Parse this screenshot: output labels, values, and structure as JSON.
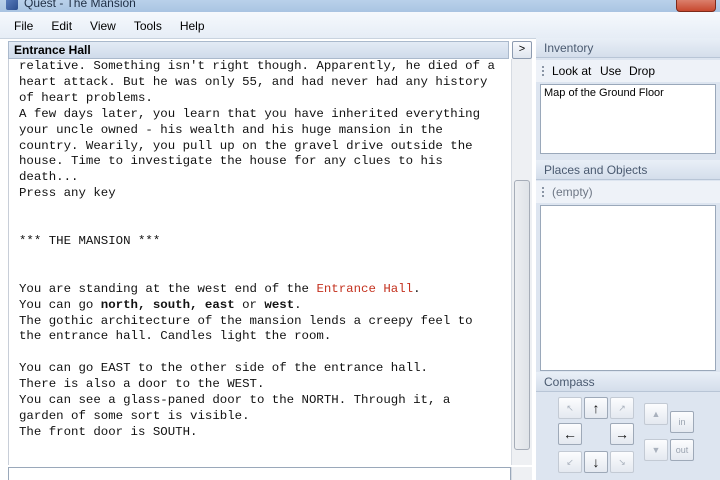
{
  "window": {
    "title": "Quest - The Mansion"
  },
  "menu": {
    "items": [
      "File",
      "Edit",
      "View",
      "Tools",
      "Help"
    ]
  },
  "location": {
    "name": "Entrance Hall",
    "toggle_label": ">"
  },
  "output": {
    "lines": [
      "relative. Something isn't right though. Apparently, he died of a",
      "heart attack. But he was only 55, and had never had any history",
      "of heart problems.",
      "A few days later, you learn that you have inherited everything",
      "your uncle owned - his wealth and his huge mansion in the",
      "country. Wearily, you pull up on the gravel drive outside the",
      "house. Time to investigate the house for any clues to his",
      "death...",
      "Press any key",
      "",
      "",
      "*** THE MANSION ***",
      "",
      "",
      "You are standing at the west end of the ",
      "You can go ",
      "The gothic architecture of the mansion lends a creepy feel to",
      "the entrance hall. Candles light the room.",
      "",
      "You can go EAST to the other side of the entrance hall.",
      "There is also a door to the WEST.",
      "You can see a glass-paned door to the NORTH. Through it, a",
      "garden of some sort is visible.",
      "The front door is SOUTH."
    ],
    "room_link": "Entrance Hall",
    "room_suffix": ".",
    "exits": {
      "north": "north,",
      "south": "south,",
      "east": "east",
      "or": " or ",
      "west": "west",
      "end": "."
    },
    "room_color": "#c4321f"
  },
  "command": {
    "value": ""
  },
  "inventory": {
    "title": "Inventory",
    "actions": [
      "Look at",
      "Use",
      "Drop"
    ],
    "items": [
      "Map of the Ground Floor"
    ]
  },
  "places": {
    "title": "Places and Objects",
    "empty_label": "(empty)",
    "items": []
  },
  "compass": {
    "title": "Compass",
    "buttons": {
      "northwest": "↖",
      "north": "↑",
      "northeast": "↗",
      "west": "←",
      "east": "→",
      "southwest": "↙",
      "south": "↓",
      "southeast": "↘",
      "up": "▲",
      "down": "▼",
      "in": "in",
      "out": "out"
    }
  }
}
